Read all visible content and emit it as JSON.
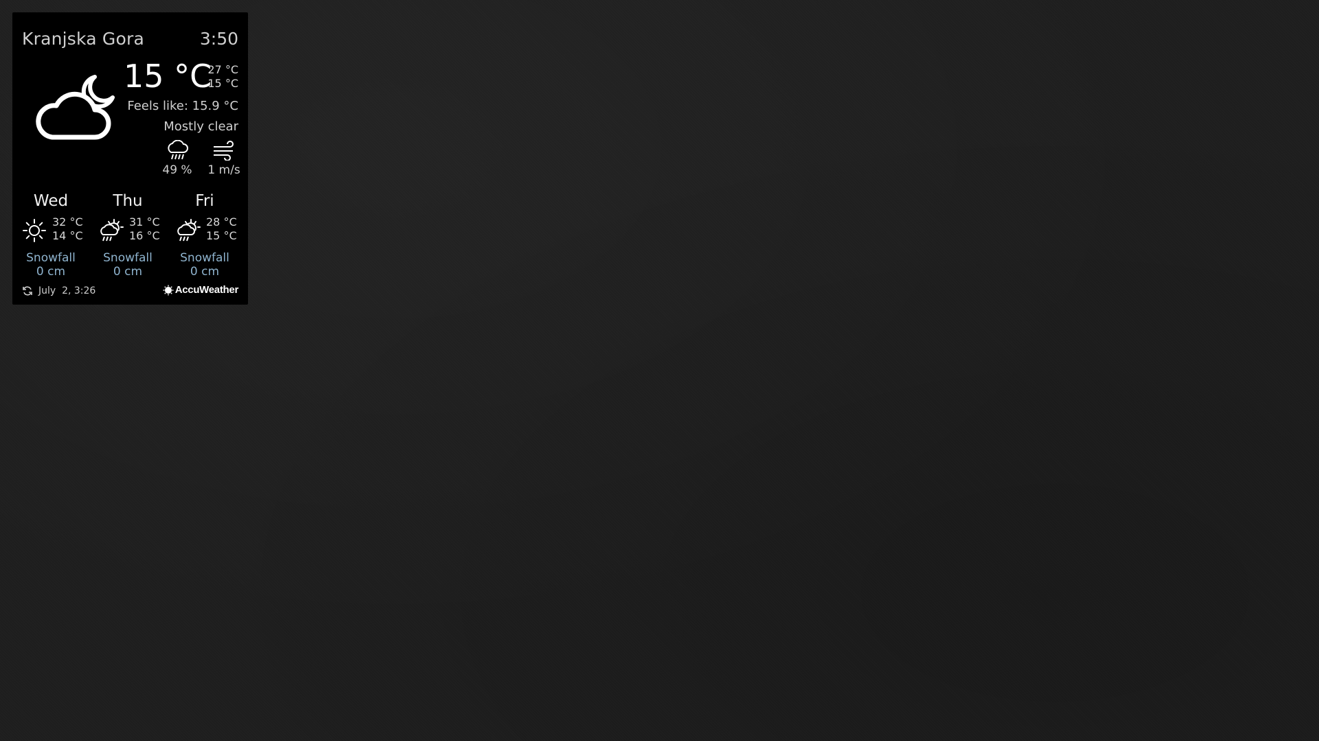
{
  "location": "Kranjska Gora",
  "time": "3:50",
  "current": {
    "icon": "partly-cloudy-night-icon",
    "temperature": "15 °C",
    "high": "27 °C",
    "low": "15 °C",
    "feels_like": "Feels like: 15.9 °C",
    "condition": "Mostly clear",
    "precipitation": "49 %",
    "wind": "1 m/s"
  },
  "forecast": [
    {
      "day": "Wed",
      "icon": "sun-icon",
      "high": "32 °C",
      "low": "14 °C",
      "snow_label": "Snowfall",
      "snow_value": "0 cm"
    },
    {
      "day": "Thu",
      "icon": "sun-rain-icon",
      "high": "31 °C",
      "low": "16 °C",
      "snow_label": "Snowfall",
      "snow_value": "0 cm"
    },
    {
      "day": "Fri",
      "icon": "sun-rain-icon",
      "high": "28 °C",
      "low": "15 °C",
      "snow_label": "Snowfall",
      "snow_value": "0 cm"
    }
  ],
  "footer": {
    "refresh_icon": "refresh-icon",
    "updated": "July  2, 3:26",
    "provider": "AccuWeather"
  },
  "colors": {
    "widget_bg": "#000000",
    "background": "#1e1e1e",
    "snow_text": "#8fb4cf"
  }
}
